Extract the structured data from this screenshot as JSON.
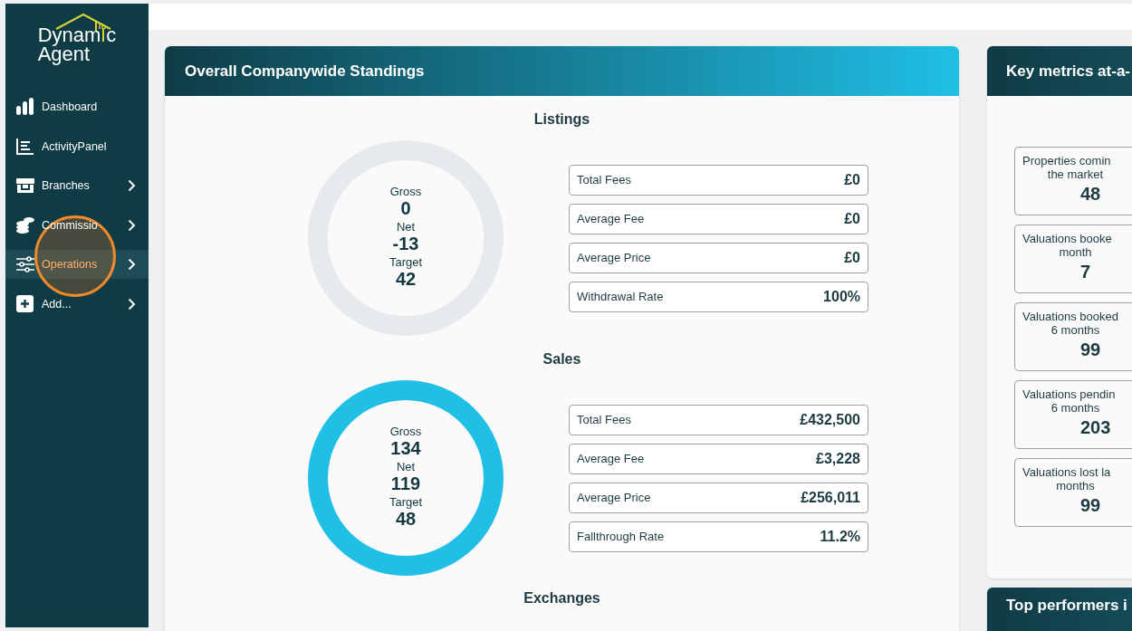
{
  "sidebar": {
    "logo": {
      "line1_left": "Dynam",
      "line1_right": "c",
      "line2": "Agent"
    },
    "items": [
      {
        "label": "Dashboard",
        "kind": "bars",
        "chevron": false,
        "selected": false
      },
      {
        "label": "ActivityPanel",
        "kind": "list",
        "chevron": false,
        "selected": false
      },
      {
        "label": "Branches",
        "kind": "shop",
        "chevron": true,
        "selected": false
      },
      {
        "label": "Commissio",
        "kind": "coins",
        "chevron": true,
        "selected": false
      },
      {
        "label": "Operations",
        "kind": "sliders",
        "chevron": true,
        "selected": true
      },
      {
        "label": "Add...",
        "kind": "plus",
        "chevron": true,
        "selected": false
      }
    ]
  },
  "main_card": {
    "title": "Overall Companywide Standings",
    "sections": [
      {
        "title": "Listings",
        "level": 0,
        "stats": [
          {
            "label": "Gross",
            "value": "0"
          },
          {
            "label": "Net",
            "value": "-13"
          },
          {
            "label": "Target",
            "value": "42"
          }
        ],
        "rows": [
          {
            "label": "Total Fees",
            "value": "£0"
          },
          {
            "label": "Average Fee",
            "value": "£0"
          },
          {
            "label": "Average Price",
            "value": "£0"
          },
          {
            "label": "Withdrawal Rate",
            "value": "100%"
          }
        ]
      },
      {
        "title": "Sales",
        "level": 1,
        "stats": [
          {
            "label": "Gross",
            "value": "134"
          },
          {
            "label": "Net",
            "value": "119"
          },
          {
            "label": "Target",
            "value": "48"
          }
        ],
        "rows": [
          {
            "label": "Total Fees",
            "value": "£432,500"
          },
          {
            "label": "Average Fee",
            "value": "£3,228"
          },
          {
            "label": "Average Price",
            "value": "£256,011"
          },
          {
            "label": "Fallthrough Rate",
            "value": "11.2%"
          }
        ]
      }
    ],
    "next_section_title": "Exchanges"
  },
  "metrics_card": {
    "title": "Key metrics at-a-",
    "metrics": [
      {
        "label_lines": [
          "Properties comin",
          "the market"
        ],
        "value": "48"
      },
      {
        "label_lines": [
          "Valuations booke",
          "month"
        ],
        "value": "7"
      },
      {
        "label_lines": [
          "Valuations booked",
          "6 months"
        ],
        "value": "99"
      },
      {
        "label_lines": [
          "Valuations pendin",
          "6 months"
        ],
        "value": "203"
      },
      {
        "label_lines": [
          "Valuations lost la",
          "months"
        ],
        "value": "99"
      }
    ]
  },
  "bottom_card": {
    "title": "Top performers i"
  }
}
